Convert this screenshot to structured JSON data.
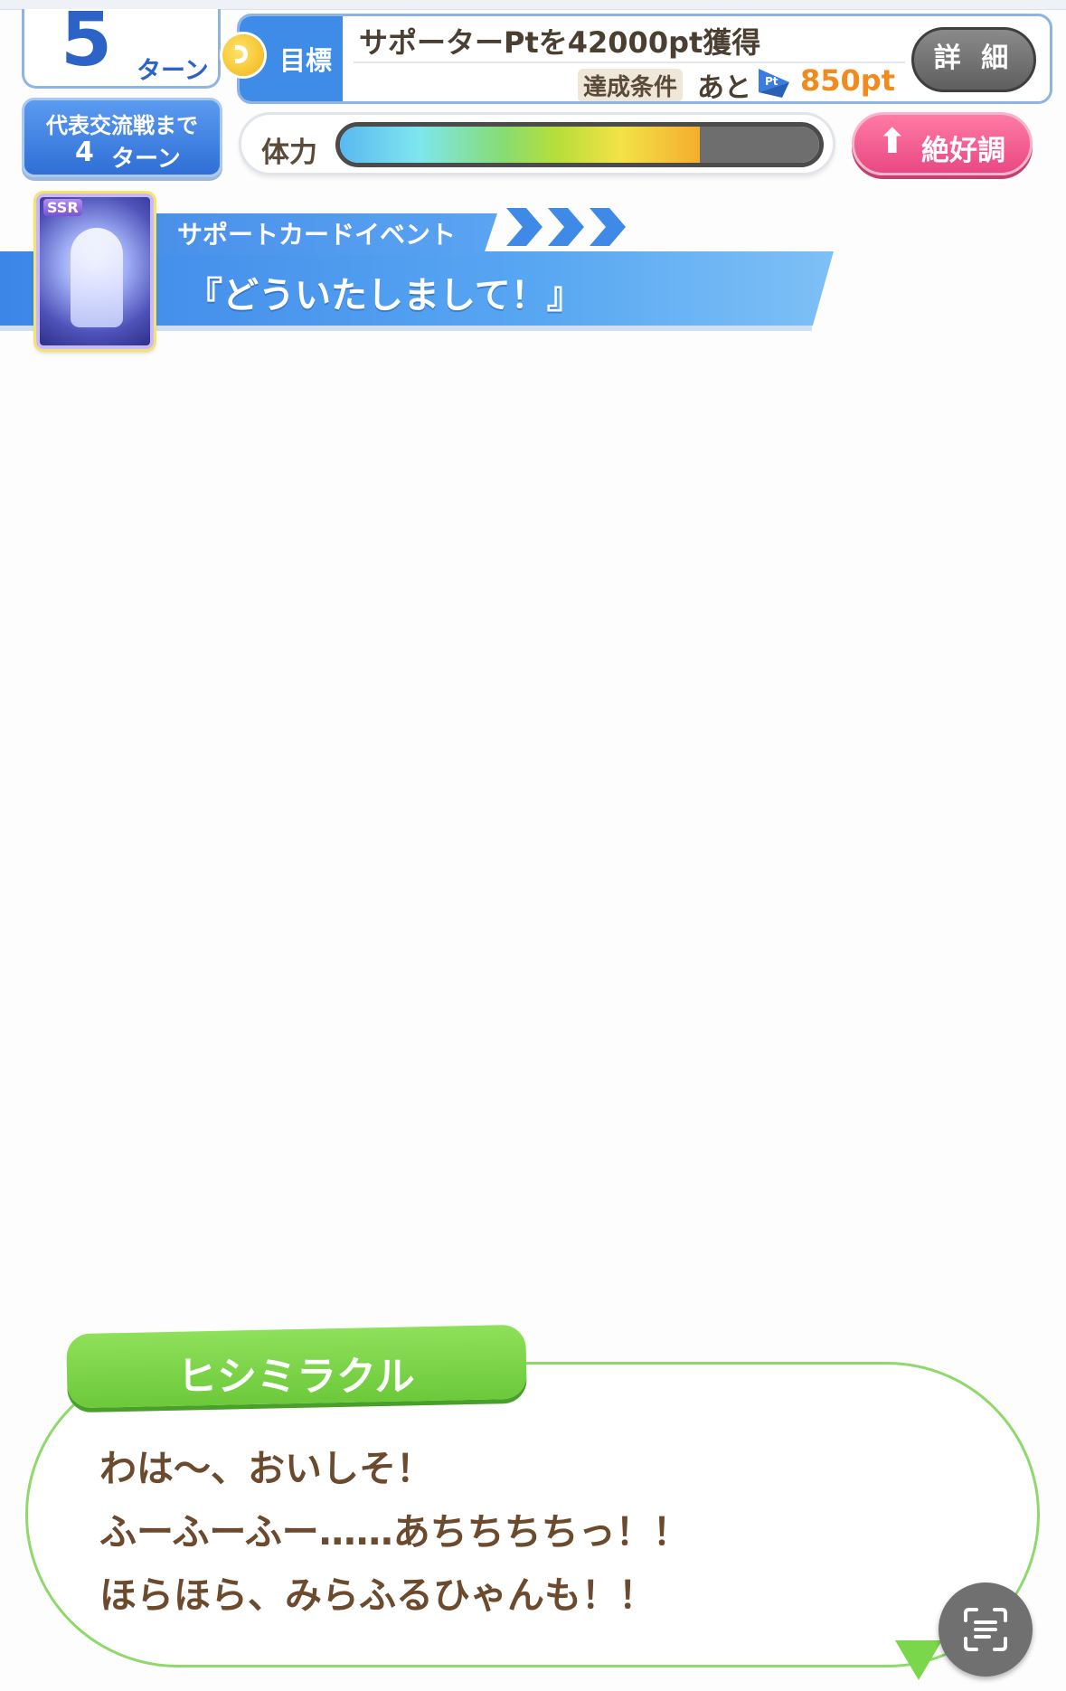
{
  "turn": {
    "number": "5",
    "unit": "ターン"
  },
  "goal": {
    "label": "目標",
    "title": "サポーターPtを42000pt獲得",
    "condition_label": "達成条件",
    "remaining_label": "あと",
    "badge_text": "Pt",
    "remaining_value": "850pt",
    "detail_button": "詳 細"
  },
  "countdown": {
    "label": "代表交流戦まで",
    "value": "4",
    "unit": "ターン"
  },
  "energy": {
    "label": "体力",
    "level": 0.75
  },
  "mood": {
    "arrow": "⬆",
    "label": "絶好調"
  },
  "event": {
    "type": "サポートカードイベント",
    "title": "『どういたしまして！』",
    "card_rarity": "SSR"
  },
  "dialog": {
    "speaker": "ヒシミラクル",
    "lines": [
      "わは～、おいしそ！",
      "ふーふーふー……あちちちちっ！！",
      "ほらほら、みらふるひゃんも！！"
    ]
  },
  "colors": {
    "accent_blue": "#3f8ce8",
    "goal_value": "#f08b1e",
    "mood_pink": "#e94882",
    "dialog_green": "#8fd86b",
    "dialog_text": "#6b4a2d"
  }
}
